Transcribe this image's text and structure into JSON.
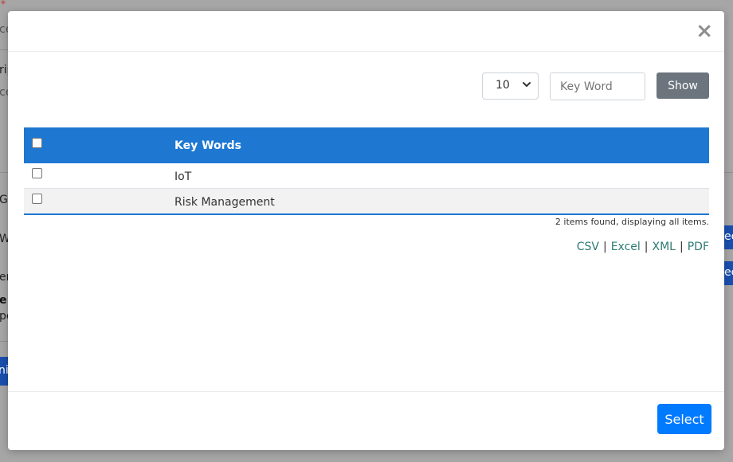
{
  "background": {
    "fragments": [
      "*",
      "ce",
      "rip",
      "ce",
      "G",
      "W",
      "ern",
      "e:",
      "pe",
      "ni",
      "ec",
      "ec"
    ]
  },
  "modal": {
    "close_glyph": "×",
    "toolbar": {
      "page_size_value": "10",
      "keyword_placeholder": "Key Word",
      "show_label": "Show"
    },
    "table": {
      "header": "Key Words",
      "rows": [
        {
          "label": "IoT"
        },
        {
          "label": "Risk Management"
        }
      ]
    },
    "items_found": "2 items found, displaying all items.",
    "export": {
      "csv": "CSV",
      "excel": "Excel",
      "xml": "XML",
      "pdf": "PDF",
      "separator": "|"
    },
    "select_label": "Select"
  },
  "colors": {
    "header_blue": "#1e78d2",
    "show_gray": "#6c757d",
    "select_blue": "#007bff",
    "link_teal": "#2d7a74"
  }
}
